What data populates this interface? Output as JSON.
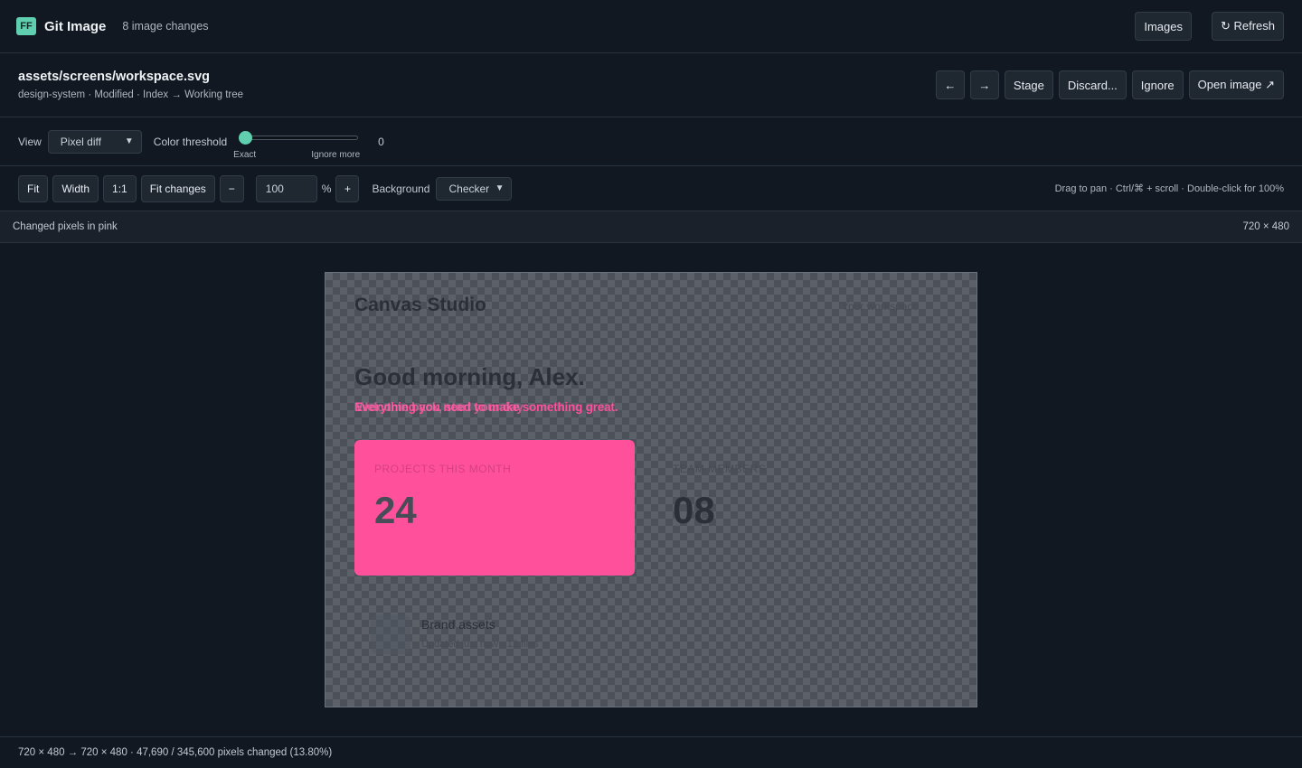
{
  "header": {
    "logo_text": "FF",
    "app_title": "Git Image",
    "changes_count": "8 image changes",
    "images_label": "Images",
    "refresh_label": "↻ Refresh"
  },
  "file": {
    "path": "assets/screens/workspace.svg",
    "meta": "design-system · Modified · Index → Working tree",
    "prev_label": "←",
    "next_label": "→",
    "stage_label": "Stage",
    "discard_label": "Discard...",
    "ignore_label": "Ignore",
    "open_label": "Open image ↗"
  },
  "view": {
    "view_label": "View",
    "mode_value": "Pixel diff",
    "threshold_label": "Color threshold",
    "threshold_min_label": "Exact",
    "threshold_max_label": "Ignore more",
    "threshold_value": "0",
    "threshold_fraction": 0
  },
  "zoom": {
    "fit_label": "Fit",
    "width_label": "Width",
    "one_to_one_label": "1:1",
    "fit_changes_label": "Fit changes",
    "minus_label": "−",
    "zoom_value": "100",
    "percent_label": "%",
    "plus_label": "+",
    "background_label": "Background",
    "background_value": "Checker",
    "hint": "Drag to pan · Ctrl/⌘ + scroll · Double-click for 100%"
  },
  "info": {
    "legend": "Changed pixels in pink",
    "dimensions": "720 × 480"
  },
  "diff_image": {
    "brand": "Canvas Studio",
    "workspace": "Your workspace",
    "greeting": "Good morning, Alex.",
    "subtitle_a": "Everything you need to make something great.",
    "subtitle_b": "Welcome back, start your day",
    "card1_label": "PROJECTS THIS MONTH",
    "card1_value": "24",
    "card2_label": "TEAM MEMBERS",
    "card2_value": "08",
    "asset_title": "Brand assets",
    "asset_meta": "Updated just now · 12 files"
  },
  "status": {
    "text": "720 × 480 → 720 × 480 · 47,690 / 345,600 pixels changed (13.80%)"
  },
  "colors": {
    "accent": "#5fcfb0",
    "diff_pink": "#ff519b",
    "background": "#111822"
  }
}
